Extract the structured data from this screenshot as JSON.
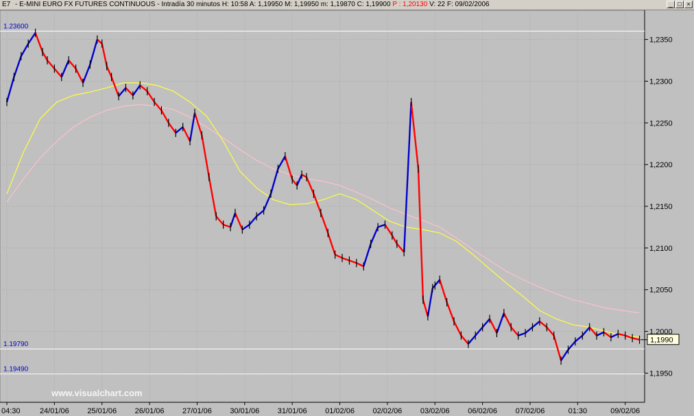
{
  "titlebar": {
    "symbol": "E7",
    "name": "- E-MINI EURO FX FUTURES CONTINUOUS",
    "interval": "- Intradía 30 minutos",
    "time": "H: 10:58",
    "open": "A: 1,19950",
    "high": "M: 1,19950",
    "low": "m: 1,19870",
    "close": "C: 1,19900",
    "prev": "P : 1,20130",
    "volume": "V: 22",
    "date": "F: 09/02/2006",
    "minimize_glyph": "_",
    "restore_glyph": "□",
    "close_glyph": "×"
  },
  "colors": {
    "background": "#c0c0c0",
    "grid": "#a8a8a8",
    "ma_short": "#ffff40",
    "ma_long": "#ffc0cb",
    "price_up": "#0000cc",
    "price_down": "#ff0000",
    "price_bar": "#000000",
    "level_line": "#ffffff",
    "level_text": "#0000cc"
  },
  "watermark": "www.visualchart.com",
  "chart_data": {
    "type": "line",
    "ylim": [
      1.1915,
      1.2385
    ],
    "yticks": [
      1.235,
      1.23,
      1.225,
      1.22,
      1.215,
      1.21,
      1.205,
      1.2,
      1.195
    ],
    "ytick_labels": [
      "1,2350",
      "1,2300",
      "1,2250",
      "1,2200",
      "1,2150",
      "1,2100",
      "1,2050",
      "1,2000",
      "1,1950"
    ],
    "x_labels": [
      "04:30",
      "24/01/06",
      "25/01/06",
      "26/01/06",
      "27/01/06",
      "30/01/06",
      "31/01/06",
      "01/02/06",
      "02/02/06",
      "03/02/06",
      "06/02/06",
      "07/02/06",
      "01:30",
      "09/02/06"
    ],
    "x_label_pos": [
      0,
      1,
      2,
      3,
      4,
      5,
      6,
      7,
      8,
      9,
      10,
      11,
      12,
      13
    ],
    "levels": [
      {
        "value": 1.236,
        "label": "1.23600"
      },
      {
        "value": 1.1979,
        "label": "1.19790"
      },
      {
        "value": 1.1949,
        "label": "1.19490"
      }
    ],
    "current_price": {
      "value": 1.199,
      "label": "1,1990"
    },
    "series": [
      {
        "style": "price",
        "x": [
          0,
          0.15,
          0.3,
          0.45,
          0.6,
          0.75,
          0.85,
          1.0,
          1.15,
          1.3,
          1.45,
          1.6,
          1.75,
          1.9,
          2.0,
          2.1,
          2.2,
          2.35,
          2.5,
          2.65,
          2.8,
          2.95,
          3.1,
          3.25,
          3.4,
          3.55,
          3.7,
          3.85,
          3.95,
          4.1,
          4.25,
          4.4,
          4.55,
          4.7,
          4.8,
          4.95,
          5.1,
          5.25,
          5.4,
          5.55,
          5.7,
          5.85,
          6.0,
          6.1,
          6.2,
          6.3,
          6.45,
          6.6,
          6.75,
          6.9,
          7.05,
          7.2,
          7.35,
          7.5,
          7.65,
          7.8,
          7.95,
          8.1,
          8.2,
          8.35,
          8.5,
          8.65,
          8.75,
          8.85,
          8.95,
          9.0,
          9.1,
          9.25,
          9.4,
          9.55,
          9.7,
          9.85,
          10.0,
          10.15,
          10.3,
          10.45,
          10.6,
          10.75,
          10.9,
          11.05,
          11.2,
          11.35,
          11.5,
          11.65,
          11.8,
          11.95,
          12.1,
          12.25,
          12.4,
          12.55,
          12.7,
          12.85,
          13.0,
          13.15,
          13.3
        ],
        "values": [
          1.2275,
          1.2305,
          1.233,
          1.2345,
          1.2358,
          1.2335,
          1.2325,
          1.2315,
          1.2305,
          1.2325,
          1.2315,
          1.2298,
          1.232,
          1.235,
          1.2345,
          1.2318,
          1.2305,
          1.2282,
          1.2292,
          1.2283,
          1.2295,
          1.2288,
          1.2275,
          1.2265,
          1.225,
          1.2238,
          1.2245,
          1.2228,
          1.2262,
          1.2235,
          1.2185,
          1.2138,
          1.2128,
          1.2125,
          1.2142,
          1.2122,
          1.2128,
          1.2138,
          1.2145,
          1.2165,
          1.2195,
          1.221,
          1.2182,
          1.2175,
          1.2188,
          1.2185,
          1.2165,
          1.2142,
          1.2118,
          1.2092,
          1.2088,
          1.2085,
          1.2082,
          1.2078,
          1.2105,
          1.2125,
          1.2128,
          1.2115,
          1.2105,
          1.2095,
          1.2275,
          1.2195,
          1.2038,
          1.2018,
          1.2052,
          1.2055,
          1.2062,
          1.2035,
          1.2012,
          1.1995,
          1.1985,
          1.1995,
          1.2005,
          1.2015,
          1.1998,
          1.2022,
          1.2005,
          1.1995,
          1.1998,
          1.2005,
          1.2012,
          1.2005,
          1.1995,
          1.1965,
          1.1978,
          1.1988,
          1.1995,
          1.2005,
          1.1995,
          1.1999,
          1.1993,
          1.1997,
          1.1995,
          1.1992,
          1.199
        ]
      },
      {
        "style": "ma_short",
        "x": [
          0,
          0.35,
          0.7,
          1.05,
          1.4,
          1.75,
          2.1,
          2.45,
          2.8,
          3.15,
          3.5,
          3.85,
          4.2,
          4.55,
          4.9,
          5.25,
          5.6,
          5.95,
          6.3,
          6.65,
          7.0,
          7.35,
          7.7,
          8.05,
          8.4,
          8.75,
          9.1,
          9.45,
          9.8,
          10.15,
          10.5,
          10.85,
          11.2,
          11.55,
          11.9,
          12.25,
          12.6,
          12.95,
          13.3
        ],
        "values": [
          1.2165,
          1.2215,
          1.2255,
          1.2275,
          1.2283,
          1.2287,
          1.2292,
          1.2298,
          1.2298,
          1.2295,
          1.2288,
          1.2275,
          1.2258,
          1.2228,
          1.2192,
          1.2172,
          1.2158,
          1.2152,
          1.2153,
          1.2158,
          1.2165,
          1.2158,
          1.2145,
          1.2132,
          1.2125,
          1.2122,
          1.2118,
          1.2108,
          1.2092,
          1.2075,
          1.2058,
          1.2042,
          1.2025,
          1.2015,
          1.2008,
          1.2005,
          1.2,
          1.1995,
          1.1993
        ]
      },
      {
        "style": "ma_long",
        "x": [
          0,
          0.35,
          0.7,
          1.05,
          1.4,
          1.75,
          2.1,
          2.45,
          2.8,
          3.15,
          3.5,
          3.85,
          4.2,
          4.55,
          4.9,
          5.25,
          5.6,
          5.95,
          6.3,
          6.65,
          7.0,
          7.35,
          7.7,
          8.05,
          8.4,
          8.75,
          9.1,
          9.45,
          9.8,
          10.15,
          10.5,
          10.85,
          11.2,
          11.55,
          11.9,
          12.25,
          12.6,
          12.95,
          13.3
        ],
        "values": [
          1.2155,
          1.2183,
          1.2208,
          1.2228,
          1.2245,
          1.2257,
          1.2265,
          1.227,
          1.2272,
          1.227,
          1.2266,
          1.2257,
          1.2245,
          1.2232,
          1.2218,
          1.2205,
          1.2195,
          1.2188,
          1.2183,
          1.218,
          1.2175,
          1.2167,
          1.2158,
          1.2148,
          1.214,
          1.2133,
          1.2125,
          1.2112,
          1.2098,
          1.2085,
          1.2072,
          1.2062,
          1.2053,
          1.2045,
          1.2038,
          1.2033,
          1.2028,
          1.2025,
          1.2022
        ]
      }
    ]
  }
}
